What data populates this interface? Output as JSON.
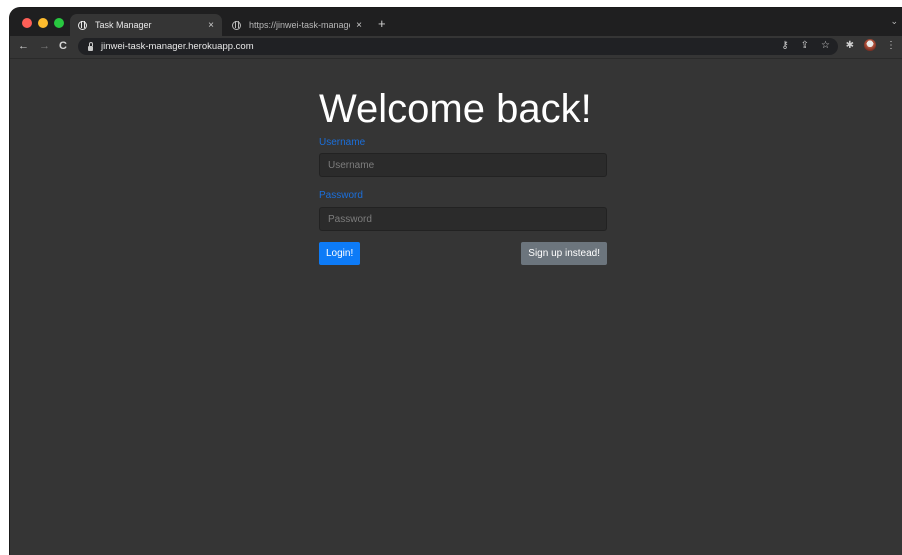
{
  "browser": {
    "tabs": [
      {
        "title": "Task Manager",
        "close": "×"
      },
      {
        "title": "https://jinwei-task-manager.he",
        "close": "×"
      }
    ],
    "new_tab": "+",
    "url": "jinwei-task-manager.herokuapp.com"
  },
  "page": {
    "heading": "Welcome back!",
    "username_label": "Username",
    "username_placeholder": "Username",
    "password_label": "Password",
    "password_placeholder": "Password",
    "login_button": "Login!",
    "signup_button": "Sign up instead!"
  },
  "colors": {
    "background": "#353535",
    "label_blue": "#1b6fdb",
    "primary_button": "#0d7bf7",
    "secondary_button": "#6c757d"
  }
}
